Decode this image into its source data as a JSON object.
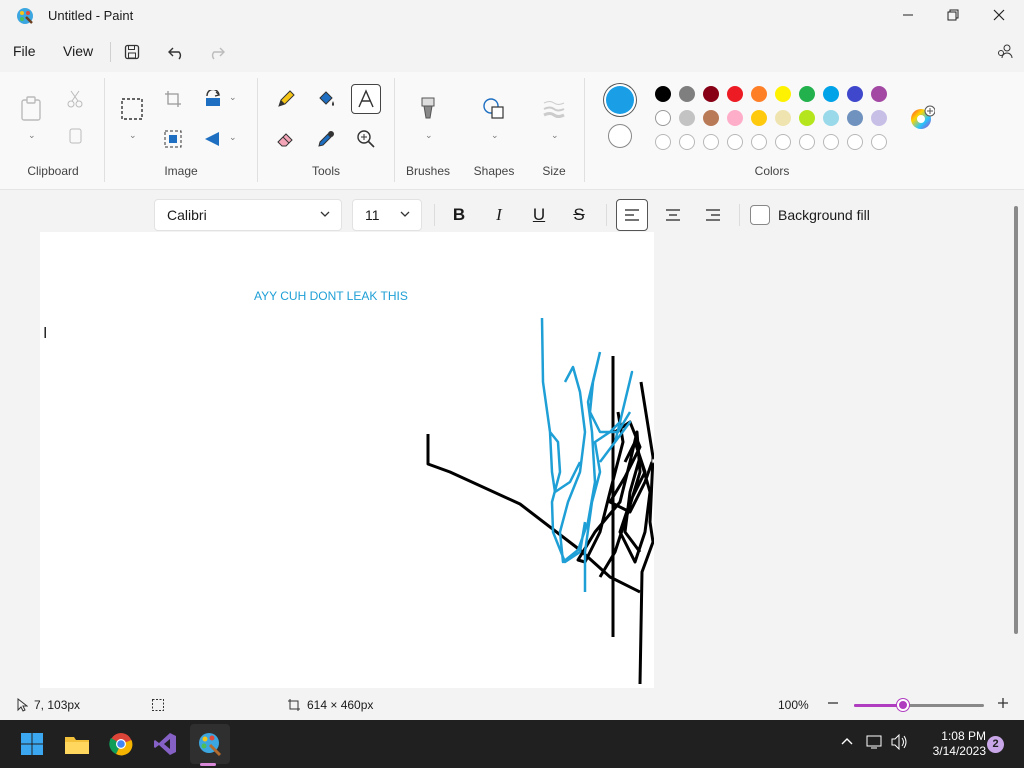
{
  "window": {
    "title": "Untitled - Paint"
  },
  "menu": {
    "file": "File",
    "view": "View"
  },
  "ribbon": {
    "groups": {
      "clipboard": "Clipboard",
      "image": "Image",
      "tools": "Tools",
      "brushes": "Brushes",
      "shapes": "Shapes",
      "size": "Size",
      "colors": "Colors"
    },
    "primary_color": "#1a9ee6",
    "secondary_color": "#ffffff",
    "palette_row1": [
      "#000000",
      "#7f7f7f",
      "#880015",
      "#ed1c24",
      "#ff7f27",
      "#fff200",
      "#22b14c",
      "#00a2e8",
      "#3f48cc",
      "#a349a4"
    ],
    "palette_row2": [
      "#ffffff",
      "#c3c3c3",
      "#b97a57",
      "#ffaec9",
      "#ffc90e",
      "#efe4b0",
      "#b5e61d",
      "#99d9ea",
      "#7092be",
      "#c8bfe7"
    ],
    "palette_row3_empty": 10
  },
  "text_format": {
    "font_family": "Calibri",
    "font_size": "11",
    "background_fill_label": "Background fill",
    "background_fill_checked": false
  },
  "canvas": {
    "text": "AYY CUH DONT LEAK THIS",
    "text_color": "#1e9fd6"
  },
  "status": {
    "cursor_position": "7, 103px",
    "canvas_size": "614 × 460px",
    "zoom": "100%",
    "zoom_fraction": 0.38,
    "zoom_accent": "#b03cc0"
  },
  "taskbar": {
    "time": "1:08 PM",
    "date": "3/14/2023",
    "notifications": "2"
  }
}
